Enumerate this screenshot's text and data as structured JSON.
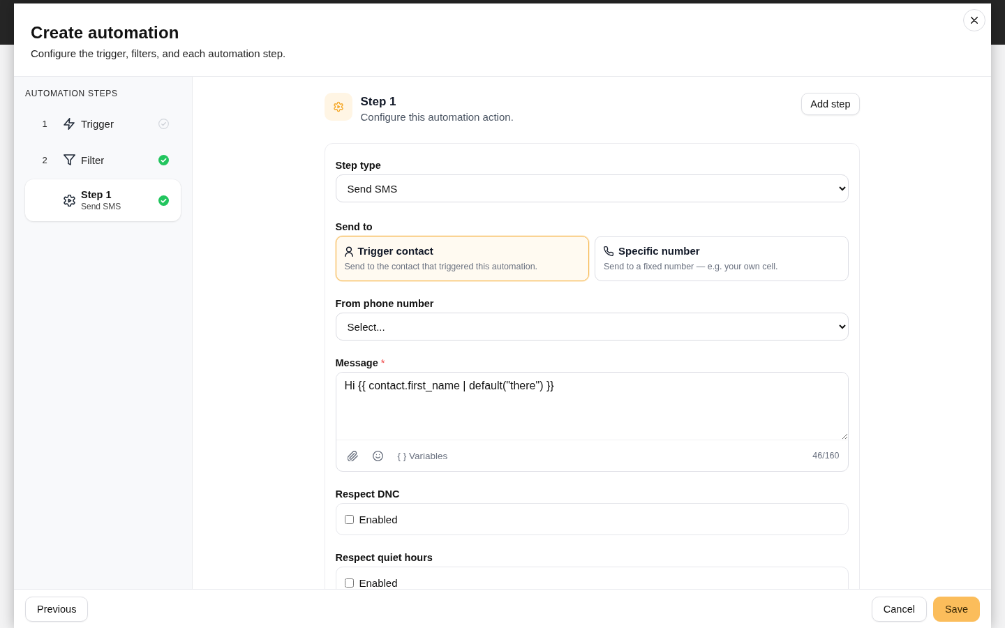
{
  "dialog": {
    "title": "Create automation",
    "subtitle": "Configure the trigger, filters, and each automation step."
  },
  "sidebar": {
    "heading": "AUTOMATION STEPS",
    "items": [
      {
        "number": "1",
        "kind": "trigger",
        "label": "Trigger",
        "complete": false,
        "selected": false
      },
      {
        "number": "2",
        "kind": "filter",
        "label": "Filter",
        "complete": true,
        "selected": false
      },
      {
        "kind": "action",
        "label": "Step 1",
        "detail": "Send SMS",
        "complete": true,
        "selected": true
      }
    ]
  },
  "step": {
    "title": "Step 1",
    "subtitle": "Configure this automation action.",
    "add_button": "Add step"
  },
  "form": {
    "fields": [
      {
        "kind": "select",
        "label": "Step type",
        "value": "Send SMS"
      },
      {
        "kind": "choice",
        "label": "Send to",
        "options": [
          {
            "kind": "contact",
            "title": "Trigger contact",
            "description": "Send to the contact that triggered this automation.",
            "selected": true
          },
          {
            "kind": "phone",
            "title": "Specific number",
            "description": "Send to a fixed number — e.g. your own cell.",
            "selected": false
          }
        ]
      },
      {
        "kind": "select",
        "label": "From phone number",
        "value": "Select..."
      },
      {
        "kind": "message",
        "label": "Message",
        "required_mark": "*",
        "value": "Hi {{ contact.first_name | default(\"there\") }}",
        "variables_button": "{ } Variables",
        "counter": "46/160"
      },
      {
        "kind": "checkbox",
        "label": "Respect DNC",
        "option": "Enabled",
        "checked": false
      },
      {
        "kind": "checkbox",
        "label": "Respect quiet hours",
        "option": "Enabled",
        "checked": false
      }
    ]
  },
  "footer": {
    "previous": "Previous",
    "cancel": "Cancel",
    "save": "Save"
  }
}
